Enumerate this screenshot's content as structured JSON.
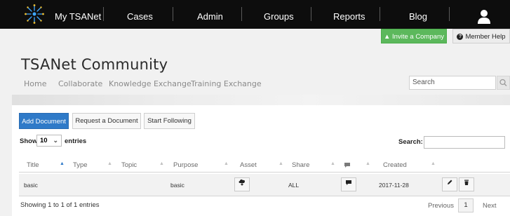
{
  "topnav": {
    "brand": "My TSANet",
    "items": [
      "Cases",
      "Admin",
      "Groups",
      "Reports",
      "Blog"
    ]
  },
  "actions": {
    "invite": "Invite a Company",
    "help": "Member Help"
  },
  "header": {
    "title": "TSANet Community",
    "subnav": [
      "Home",
      "Collaborate",
      "Knowledge Exchange",
      "Training Exchange"
    ],
    "search_placeholder": "Search"
  },
  "toolbar": {
    "add_document": "Add Document",
    "request_document": "Request a Document",
    "start_following": "Start Following"
  },
  "length_menu": {
    "show": "Show",
    "value": "10",
    "entries": "entries"
  },
  "search_label": "Search:",
  "table": {
    "columns": [
      "Title",
      "Type",
      "Topic",
      "Purpose",
      "Asset",
      "Share",
      "",
      "Created",
      ""
    ],
    "rows": [
      {
        "title": "basic",
        "type": "",
        "topic": "",
        "purpose": "basic",
        "share": "ALL",
        "created": "2017-11-28"
      }
    ]
  },
  "footer": {
    "info": "Showing 1 to 1 of 1 entries",
    "previous": "Previous",
    "page": "1",
    "next": "Next"
  },
  "colors": {
    "primary": "#2f7ac8",
    "success": "#5cb85c",
    "nav_bg": "#0d0d0d"
  }
}
